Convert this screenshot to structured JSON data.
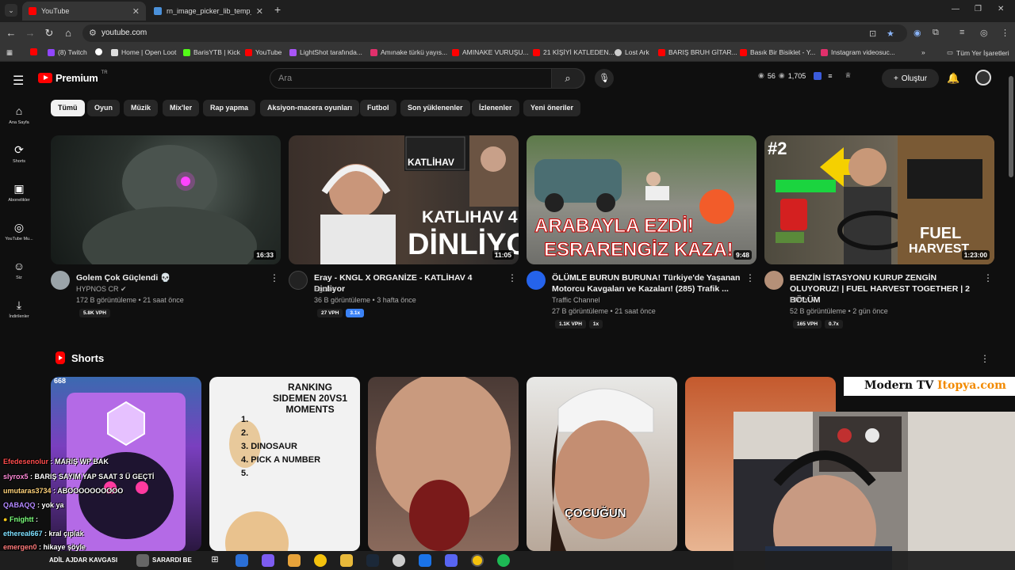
{
  "browser": {
    "tabs": [
      {
        "title": "YouTube",
        "favicon_color": "#ff0000"
      },
      {
        "title": "rn_image_picker_lib_temp_4e8d",
        "favicon_color": "#4a90d9"
      }
    ],
    "url": "youtube.com",
    "bookmarks": [
      {
        "label": "(8) Twitch",
        "color": "#9146ff"
      },
      {
        "label": "Home | Open Loot",
        "color": "#ffffff"
      },
      {
        "label": "BarisYTB | Kick",
        "color": "#53fc18"
      },
      {
        "label": "YouTube",
        "color": "#ff0000"
      },
      {
        "label": "LightShot tarafında...",
        "color": "#a855f7"
      },
      {
        "label": "Amınake türkü yayıs...",
        "color": "#e1306c"
      },
      {
        "label": "AMINAKE VURUŞU...",
        "color": "#ff0000"
      },
      {
        "label": "21 KİŞİYİ KATLEDEN...",
        "color": "#ff0000"
      },
      {
        "label": "Lost Ark",
        "color": "#cccccc"
      },
      {
        "label": "BARIŞ BRUH GİTAR...",
        "color": "#ff0000"
      },
      {
        "label": "Basık Bir Bisiklet - Y...",
        "color": "#ff0000"
      },
      {
        "label": "Instagram videosuc...",
        "color": "#e1306c"
      }
    ],
    "all_bookmarks": "Tüm Yer İşaretleri"
  },
  "masthead": {
    "logo_text": "Premium",
    "country": "TR",
    "search_placeholder": "Ara",
    "stat_views": "56",
    "stat_count": "1,705",
    "create_label": "Oluştur"
  },
  "guide": [
    {
      "label": "Ana Sayfa",
      "icon": "home-icon"
    },
    {
      "label": "Shorts",
      "icon": "shorts-icon"
    },
    {
      "label": "Abonelikler",
      "icon": "subscriptions-icon"
    },
    {
      "label": "YouTube Mu...",
      "icon": "music-icon"
    },
    {
      "label": "Siz",
      "icon": "user-icon"
    },
    {
      "label": "İndirilenler",
      "icon": "download-icon"
    }
  ],
  "chips": [
    "Tümü",
    "Oyun",
    "Müzik",
    "Mix'ler",
    "Rap yapma",
    "Aksiyon-macera oyunları",
    "Futbol",
    "Son yüklenenler",
    "İzlenenler",
    "Yeni öneriler"
  ],
  "videos": [
    {
      "title": "Golem Çok Güçlendi 💀",
      "channel": "HYPNOS CR",
      "views": "172 B görüntüleme • 21 saat önce",
      "duration": "16:33",
      "badges": [
        "5.8K VPH"
      ],
      "thumb_text": ""
    },
    {
      "title": "Eray - KNGL X ORGANİZE - KATLİHAV 4 Dinliyor",
      "channel": "Egolee",
      "views": "36 B görüntüleme • 3 hafta önce",
      "duration": "11:05",
      "badges": [
        "27 VPH",
        "3.1x"
      ],
      "thumb_text": "KATLIHAV 4 DİNLİYOR"
    },
    {
      "title": "ÖLÜMLE BURUN BURUNA! Türkiye'de Yaşanan Motorcu Kavgaları ve Kazaları! (285) Trafik ...",
      "channel": "Traffic Channel",
      "views": "27 B görüntüleme • 21 saat önce",
      "duration": "9:48",
      "badges": [
        "1.1K VPH",
        "1x"
      ],
      "thumb_text": "ARABAYLA EZDİ! ESRARENGİZ KAZA!"
    },
    {
      "title": "BENZİN İSTASYONU KURUP ZENGİN OLUYORUZ! | FUEL HARVEST TOGETHER | 2 BÖLÜM",
      "channel": "ERAY",
      "views": "52 B görüntüleme • 2 gün önce",
      "duration": "1:23:00",
      "badges": [
        "165 VPH",
        "0.7x"
      ],
      "thumb_text": "FUEL HARVEST"
    }
  ],
  "shorts": {
    "title": "Shorts",
    "items": [
      {
        "overlay": "668"
      },
      {
        "overlay": "RANKING SIDEMEN 20VS1 MOMENTS",
        "list": [
          "1.",
          "2.",
          "3. DINOSAUR",
          "4. PICK A NUMBER",
          "5."
        ]
      },
      {
        "overlay": ""
      },
      {
        "overlay": "ÇOCUĞUN"
      },
      {
        "overlay": ""
      }
    ]
  },
  "stream": {
    "brand_a": "Modern TV",
    "brand_b": "Itopya.com",
    "chat": [
      {
        "user": "Efedesenolur",
        "msg": "MARIŞ WP BAK",
        "color": "#ff4d4d"
      },
      {
        "user": "slyrox5",
        "msg": "BARIŞ SAYIM YAP SAAT 3 Ü GEÇTİ",
        "color": "#ff8ad8"
      },
      {
        "user": "umutaras3734",
        "msg": "ABOOOOOOOOOO",
        "color": "#ffd37a"
      },
      {
        "user": "QABAQQ",
        "msg": "yok ya",
        "color": "#b388ff"
      },
      {
        "user": "Fnightt",
        "msg": "",
        "color": "#7dff7d"
      },
      {
        "user": "ethereal667",
        "msg": "kral çıplak",
        "color": "#7ee0ff"
      },
      {
        "user": "emergen0",
        "msg": "hikaye şöyle",
        "color": "#ff7b7b"
      }
    ]
  },
  "taskbar": {
    "items": [
      "ADİL AJDAR KAVGASI",
      "SARARDI BE"
    ]
  }
}
